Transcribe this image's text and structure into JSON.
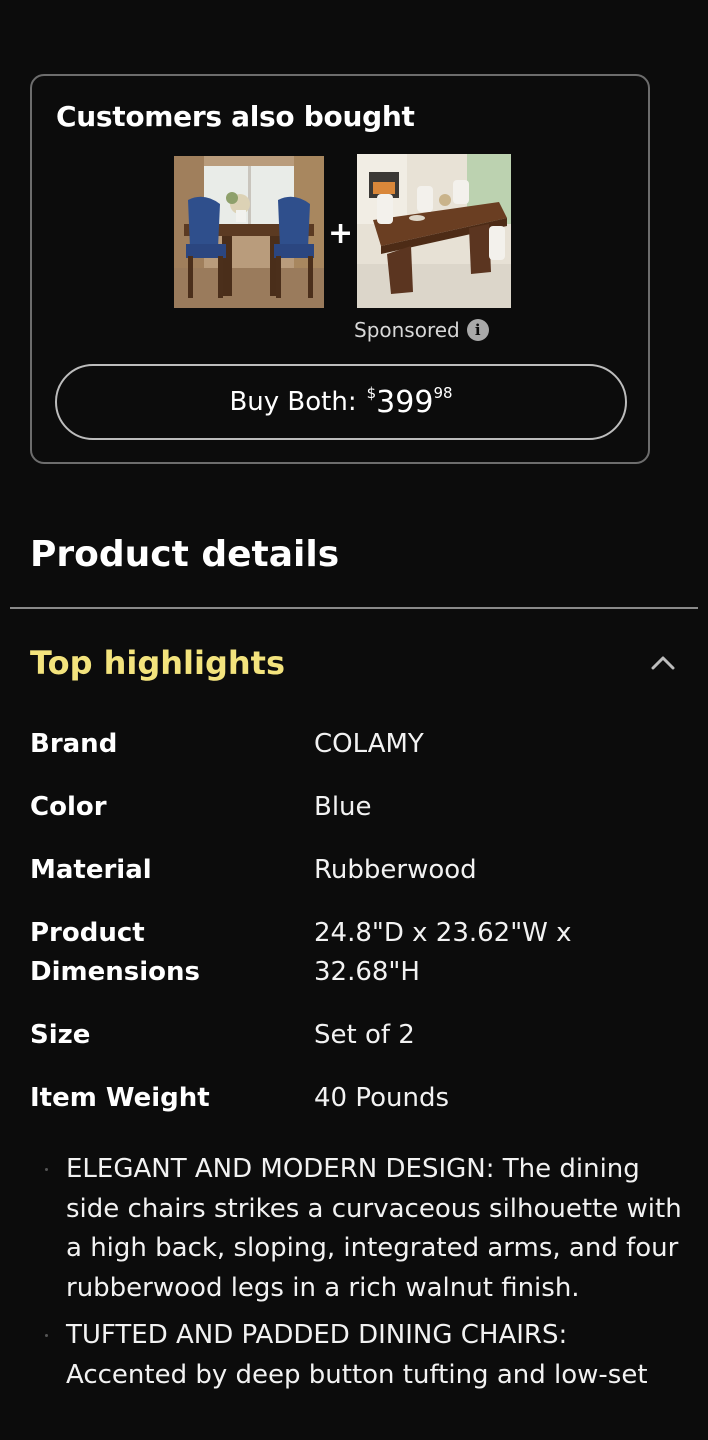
{
  "customers_also_bought": {
    "title": "Customers also bought",
    "plus": "+",
    "sponsored_label": "Sponsored",
    "buy_both_label": "Buy Both:",
    "price_currency": "$",
    "price_whole": "399",
    "price_fraction": "98"
  },
  "product_details": {
    "title": "Product details",
    "top_highlights_title": "Top highlights",
    "specs": [
      {
        "label": "Brand",
        "value": "COLAMY"
      },
      {
        "label": "Color",
        "value": "Blue"
      },
      {
        "label": "Material",
        "value": "Rubberwood"
      },
      {
        "label": "Product Dimensions",
        "value": "24.8\"D x 23.62\"W x 32.68\"H"
      },
      {
        "label": "Size",
        "value": "Set of 2"
      },
      {
        "label": "Item Weight",
        "value": "40 Pounds"
      }
    ],
    "bullets": [
      "ELEGANT AND MODERN DESIGN: The dining side chairs strikes a curvaceous silhouette with a high back, sloping, integrated arms, and four rubberwood legs in a rich walnut finish.",
      "TUFTED AND PADDED DINING CHAIRS: Accented by deep button tufting and low-set"
    ]
  },
  "colors": {
    "background": "#0c0c0c",
    "highlight_title": "#f3e37d",
    "card_border": "#6d6d6d",
    "chair_blue": "#2f4f8c"
  },
  "icons": {
    "info": "info-icon",
    "collapse": "chevron-up-icon"
  }
}
